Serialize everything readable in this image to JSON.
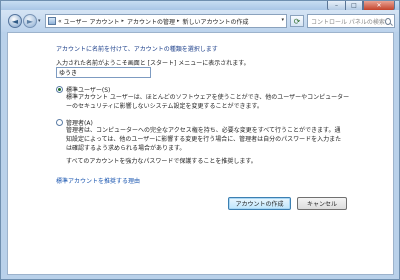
{
  "window": {
    "caption_buttons": {
      "minimize": "–",
      "maximize": "□",
      "close": "✕"
    }
  },
  "nav": {
    "back_glyph": "◄",
    "forward_glyph": "►",
    "dropdown_glyph": "▾",
    "refresh_glyph": "⟳"
  },
  "address": {
    "prefix": "«",
    "crumbs": [
      "ユーザー アカウント",
      "アカウントの管理",
      "新しいアカウントの作成"
    ],
    "separator": "▸",
    "dropdown_glyph": "▾"
  },
  "search": {
    "placeholder": "コントロール パネルの検索"
  },
  "form": {
    "instruction": "アカウントに名前を付けて、アカウントの種類を選択します",
    "name_label": "入力された名前がようこそ画面と [スタート] メニューに表示されます。",
    "name_value": "ゆうき",
    "options": [
      {
        "label": "標準ユーザー(S)",
        "checked": true,
        "description": [
          "標準アカウント ユーザーは、ほとんどのソフトウェアを使うことができ、他のユーザーやコンピューター",
          "ーのセキュリティに影響しないシステム設定を変更することができます。"
        ]
      },
      {
        "label": "管理者(A)",
        "checked": false,
        "description": [
          "管理者は、コンピューターへの完全なアクセス権を持ち、必要な変更をすべて行うことができます。通",
          "知設定によっては、他のユーザーに影響する変更を行う場合に、管理者は自分のパスワードを入力また",
          "は確認するよう求められる場合があります。"
        ]
      }
    ],
    "note": "すべてのアカウントを強力なパスワードで保護することを推奨します。",
    "link": "標準アカウントを推奨する理由",
    "buttons": {
      "create": "アカウントの作成",
      "cancel": "キャンセル"
    }
  }
}
